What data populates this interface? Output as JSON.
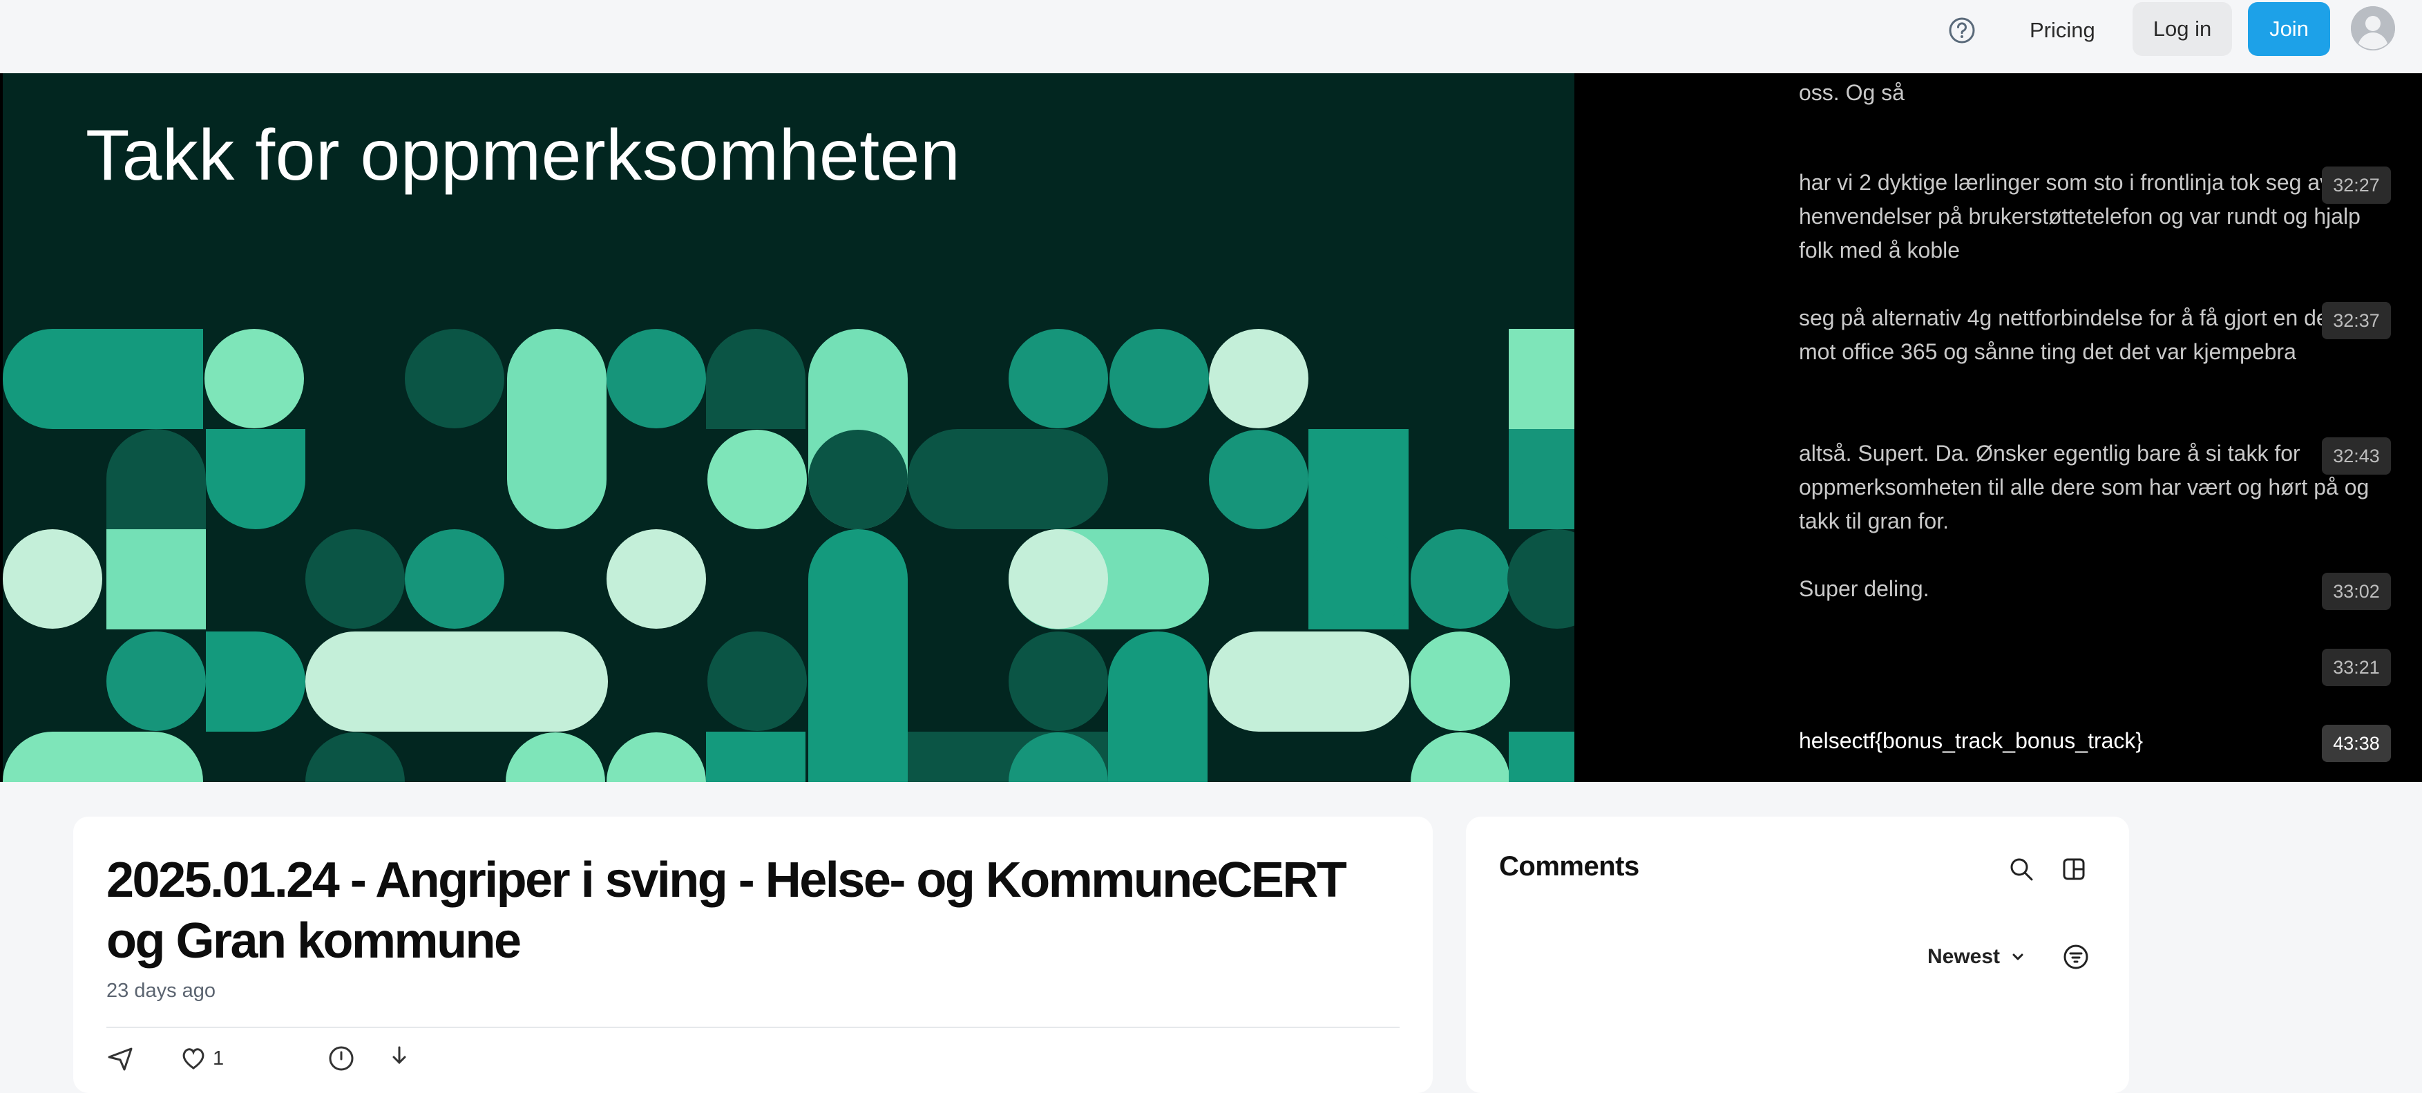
{
  "nav": {
    "help_icon": "question-circle-icon",
    "pricing_label": "Pricing",
    "login_label": "Log in",
    "join_label": "Join",
    "accent_color": "#1da1e8"
  },
  "slide": {
    "title": "Takk for oppmerksomheten",
    "background_color": "#022620"
  },
  "transcript": {
    "items": [
      {
        "text": "oss. Og så",
        "time": ""
      },
      {
        "text": "har vi 2 dyktige lærlinger som sto i frontlinja tok seg av alle henvendelser på brukerstøttetelefon og var rundt og hjalp folk med å koble",
        "time": "32:27"
      },
      {
        "text": "seg på alternativ 4g nettforbindelse for å få gjort en del jobb mot office 365 og sånne ting det det var kjempebra",
        "time": "32:37"
      },
      {
        "text": "altså. Supert. Da. Ønsker egentlig bare å si takk for oppmerksomheten til alle dere som har vært og hørt på og takk til gran for.",
        "time": "32:43"
      },
      {
        "text": "Super deling.",
        "time": "33:02"
      },
      {
        "text": "",
        "time": "33:21"
      },
      {
        "text": "helsectf{bonus_track_bonus_track}",
        "time": "43:38"
      }
    ]
  },
  "video": {
    "title": "2025.01.24 - Angriper i sving - Helse- og KommuneCERT og Gran kommune",
    "posted": "23 days ago",
    "likes": "1"
  },
  "comments": {
    "title": "Comments",
    "sort_label": "Newest"
  }
}
